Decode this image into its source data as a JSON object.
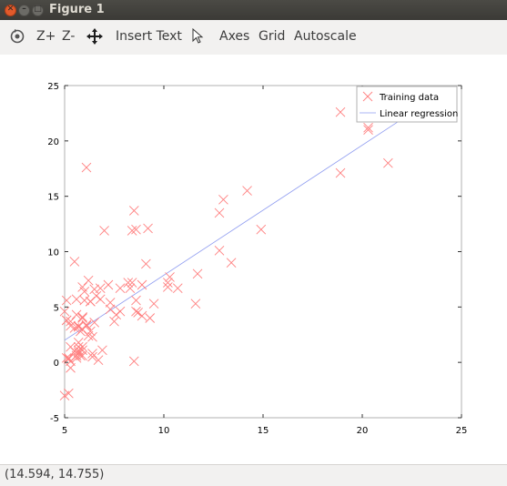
{
  "window": {
    "title": "Figure 1"
  },
  "toolbar": {
    "rotate_icon": "rotate-icon",
    "zoom_in_label": "Z+",
    "zoom_out_label": "Z-",
    "pan_icon": "pan-icon",
    "insert_text_label": "Insert Text",
    "select_icon": "pointer-icon",
    "axes_label": "Axes",
    "grid_label": "Grid",
    "autoscale_label": "Autoscale"
  },
  "status": {
    "coords": "(14.594, 14.755)"
  },
  "colors": {
    "training": "#ff7f7f",
    "regression": "#8f9cf0"
  },
  "chart_data": {
    "type": "scatter",
    "title": "",
    "xlabel": "",
    "ylabel": "",
    "xlim": [
      5,
      25
    ],
    "ylim": [
      -5,
      25
    ],
    "xticks": [
      "5",
      "10",
      "15",
      "20",
      "25"
    ],
    "yticks": [
      "-5",
      "0",
      "5",
      "10",
      "15",
      "20",
      "25"
    ],
    "grid": false,
    "legend_position": "top-right",
    "series": [
      {
        "name": "Training data",
        "marker": "x",
        "x": [
          6.1,
          5.5,
          8.5,
          7.0,
          5.9,
          8.4,
          5.6,
          8.6,
          6.5,
          5.1,
          5.7,
          14.2,
          5.7,
          5.3,
          6.4,
          6.9,
          5.2,
          6.0,
          5.3,
          7.3,
          8.2,
          5.1,
          7.6,
          6.6,
          5.6,
          6.8,
          5.6,
          5.9,
          6.3,
          5.9,
          5.3,
          6.2,
          5.2,
          13.4,
          8.3,
          12.8,
          5.5,
          5.2,
          5.8,
          6.3,
          9.2,
          21.3,
          5.1,
          5.5,
          20.3,
          8.9,
          11.6,
          10.7,
          12.8,
          8.9,
          6.8,
          6.3,
          5.7,
          5.9,
          5.7,
          8.5,
          5.9,
          5.3,
          7.5,
          10.3,
          5.6,
          18.9,
          5.7,
          5.8,
          6.1,
          5.9,
          9.5,
          6.5,
          7.3,
          6.4,
          10.2,
          5.7,
          7.2,
          6.4,
          6.7,
          5.1,
          8.6,
          5.3,
          7.8,
          8.4,
          9.3,
          6.2,
          6.1,
          5.9,
          7.8,
          9.1,
          13.0,
          18.9,
          20.3,
          10.2,
          8.6,
          14.9,
          5.0,
          5.0,
          8.7,
          6.0,
          11.7
        ],
        "y": [
          17.6,
          9.1,
          13.7,
          11.9,
          6.8,
          11.9,
          4.3,
          12.0,
          6.6,
          3.8,
          3.3,
          15.5,
          3.2,
          3.3,
          0.8,
          1.1,
          0.3,
          5.6,
          3.7,
          5.4,
          7.2,
          3.8,
          4.3,
          6.0,
          5.7,
          6.7,
          0.6,
          1.4,
          5.5,
          0.6,
          0.1,
          2.4,
          -2.8,
          9.0,
          6.7,
          13.5,
          1.0,
          0.4,
          0.6,
          2.8,
          12.1,
          18.0,
          5.6,
          3.1,
          21.2,
          4.2,
          5.3,
          6.7,
          10.1,
          7.0,
          5.7,
          5.5,
          1.1,
          1.1,
          0.9,
          0.1,
          3.0,
          -0.5,
          3.7,
          7.7,
          0.4,
          22.6,
          1.8,
          2.8,
          3.4,
          4.0,
          5.3,
          3.6,
          4.8,
          2.3,
          6.8,
          1.4,
          7.0,
          0.5,
          0.2,
          0.4,
          5.6,
          1.4,
          4.6,
          7.2,
          4.0,
          7.4,
          3.3,
          4.1,
          6.7,
          8.9,
          14.7,
          17.1,
          21.0,
          7.2,
          4.6,
          12.0,
          4.6,
          -3.0,
          4.5,
          6.4,
          8.0
        ]
      },
      {
        "name": "Linear regression",
        "type": "line",
        "x": [
          5.0,
          22.2
        ],
        "y": [
          2.0,
          22.2
        ]
      }
    ]
  }
}
